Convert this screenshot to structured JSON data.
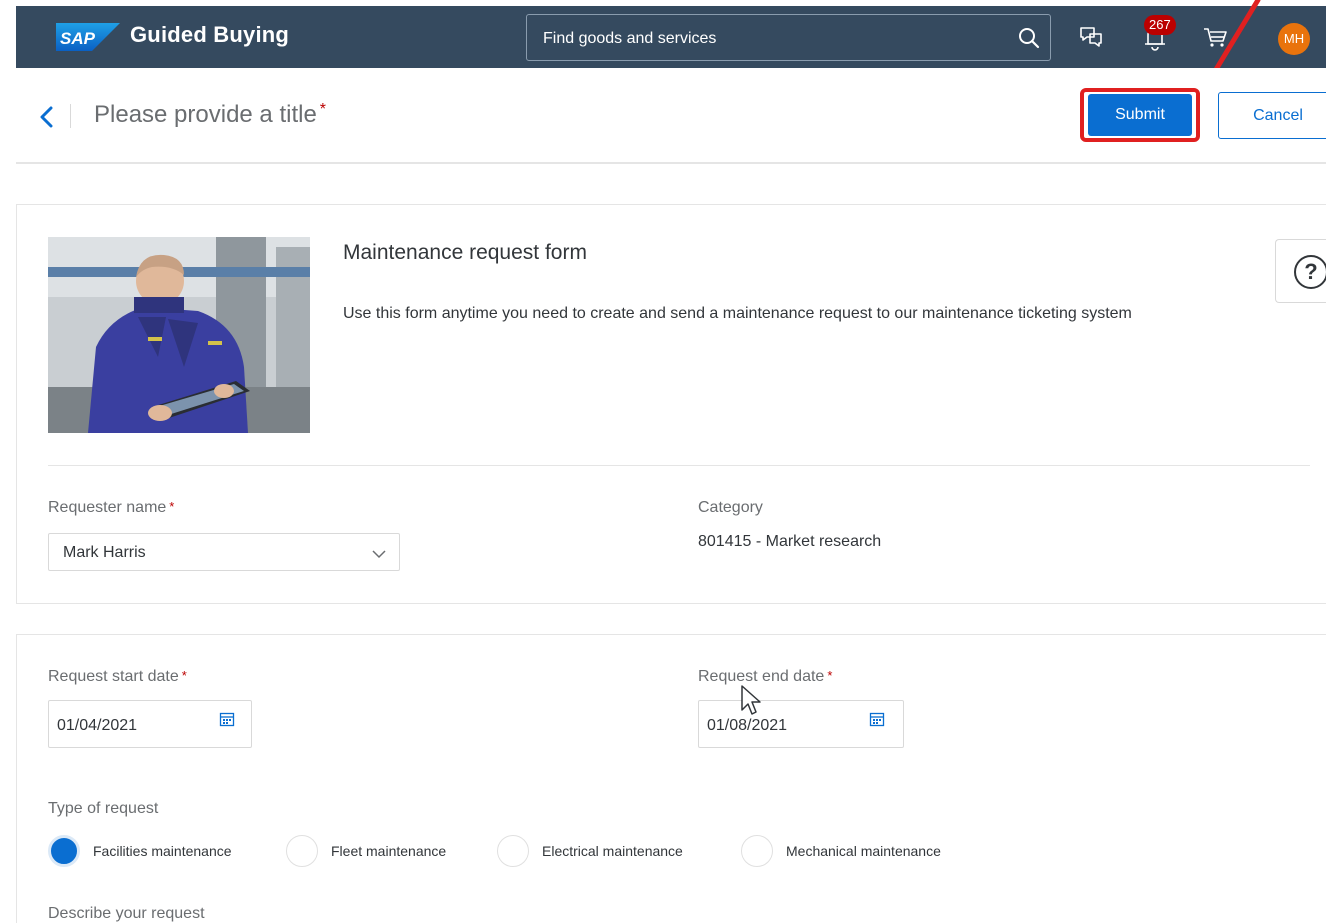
{
  "shell": {
    "logo_text": "SAP",
    "app_title": "Guided Buying",
    "search_placeholder": "Find goods and services",
    "notification_count": "267",
    "avatar_initials": "MH"
  },
  "header": {
    "title": "Please provide a title",
    "required_mark": "*",
    "submit_label": "Submit",
    "cancel_label": "Cancel"
  },
  "form": {
    "title": "Maintenance request form",
    "description": "Use this form anytime you need to create and send a maintenance request to our maintenance ticketing system",
    "help_symbol": "?",
    "requester_label": "Requester name",
    "requester_value": "Mark Harris",
    "category_label": "Category",
    "category_value": "801415 - Market research"
  },
  "details": {
    "start_label": "Request start date",
    "start_value": "01/04/2021",
    "end_label": "Request end date",
    "end_value": "01/08/2021",
    "type_label": "Type of request",
    "types": [
      {
        "label": "Facilities maintenance",
        "selected": true
      },
      {
        "label": "Fleet maintenance",
        "selected": false
      },
      {
        "label": "Electrical maintenance",
        "selected": false
      },
      {
        "label": "Mechanical maintenance",
        "selected": false
      }
    ],
    "describe_label": "Describe your request"
  },
  "colors": {
    "shell_bg": "#354a5f",
    "brand_blue": "#0a6ed1",
    "highlight_red": "#e02020",
    "badge_red": "#bb0000",
    "avatar_orange": "#e9730c"
  }
}
